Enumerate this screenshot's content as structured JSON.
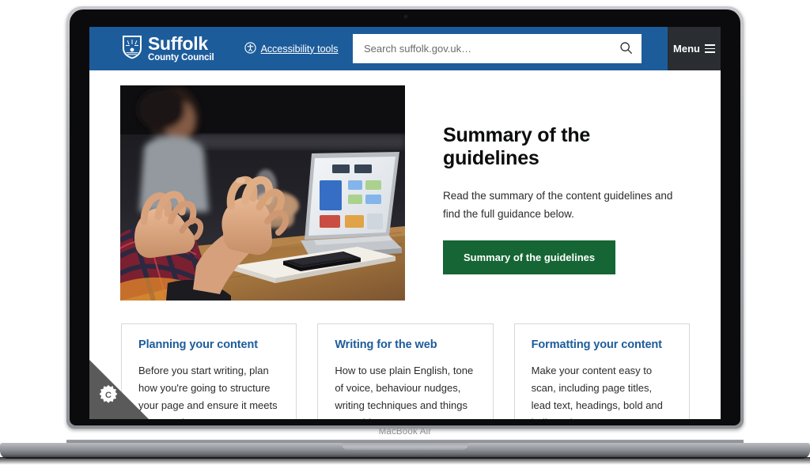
{
  "device": {
    "brand_label": "MacBook Air",
    "camera_icon": "camera-dot-icon"
  },
  "site_header": {
    "logo": {
      "crest_icon": "suffolk-crest-icon",
      "name": "Suffolk",
      "subtitle": "County Council"
    },
    "accessibility": {
      "icon": "accessibility-person-icon",
      "label": "Accessibility tools"
    },
    "search": {
      "placeholder": "Search suffolk.gov.uk…",
      "value": "",
      "submit_icon": "search-icon"
    },
    "menu": {
      "label": "Menu",
      "icon": "hamburger-menu-icon"
    },
    "background_color": "#1d5c9b",
    "menu_background_color": "#2a2d31"
  },
  "hero": {
    "image_alt": "Two people at a desk discussing, one gesturing with hands, open laptop and phone on notebook",
    "title": "Summary of the guidelines",
    "body": "Read the summary of the content guidelines and find the full guidance below.",
    "cta_label": "Summary of the guidelines",
    "cta_color": "#166534"
  },
  "cards": [
    {
      "title": "Planning your content",
      "body": "Before you start writing, plan how you're going to structure your page and ensure it meets user needs."
    },
    {
      "title": "Writing for the web",
      "body": "How to use plain English, tone of voice, behaviour nudges, writing techniques and things to avoid."
    },
    {
      "title": "Formatting your content",
      "body": "Make your content easy to scan, including page titles, lead text, headings, bold and bullet points."
    }
  ],
  "cookie_widget": {
    "icon": "cookie-settings-cog-icon",
    "letter": "C",
    "background_color": "#5a5a5a"
  },
  "colors": {
    "brand_blue": "#1d5c9b",
    "link_blue": "#1d5c9b",
    "green": "#166534",
    "text": "#0b0c0c",
    "card_border": "#d8d8d8"
  }
}
